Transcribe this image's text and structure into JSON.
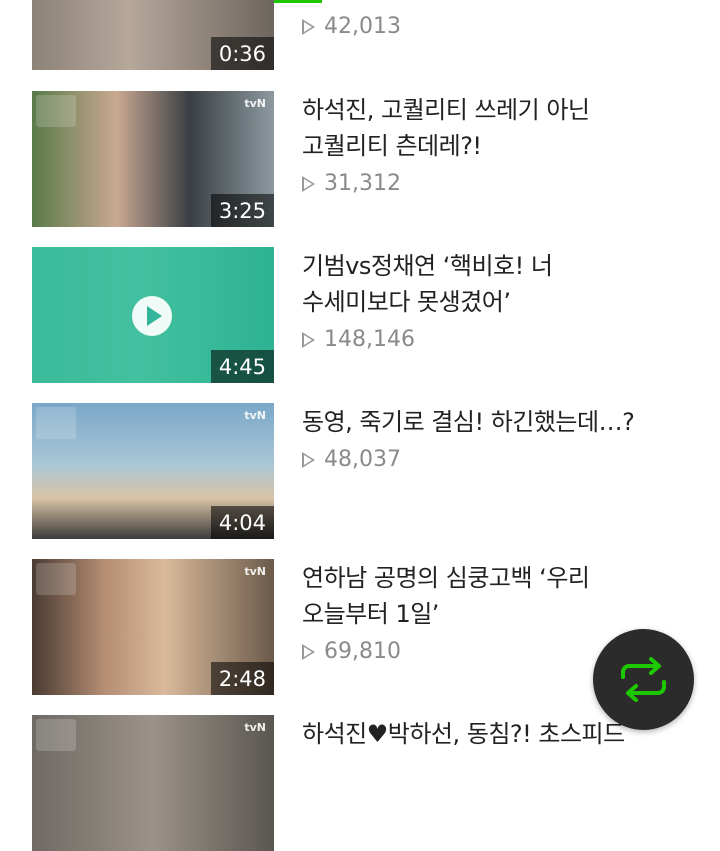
{
  "videos": [
    {
      "title_line1": "",
      "title_line2": "",
      "views": "42,013",
      "duration": "0:36"
    },
    {
      "title_line1": "하석진, 고퀄리티 쓰레기 아닌",
      "title_line2": "고퀄리티 츤데레?!",
      "views": "31,312",
      "duration": "3:25",
      "channel_logo": "tvN"
    },
    {
      "title_line1": "기범vs정채연 ‘핵비호! 너",
      "title_line2": "수세미보다 못생겼어’",
      "views": "148,146",
      "duration": "4:45"
    },
    {
      "title_line1": "동영, 죽기로 결심! 하긴했는데…?",
      "title_line2": "",
      "views": "48,037",
      "duration": "4:04",
      "channel_logo": "tvN"
    },
    {
      "title_line1": "연하남 공명의 심쿵고백 ‘우리",
      "title_line2": "오늘부터 1일’",
      "views": "69,810",
      "duration": "2:48",
      "channel_logo": "tvN"
    },
    {
      "title_line1": "하석진♥박하선, 동침?! 초스피드",
      "title_line2": "",
      "views": "",
      "duration": "",
      "channel_logo": "tvN"
    }
  ],
  "accent_color": "#1ec800",
  "fab": {
    "icon": "repeat-icon",
    "color": "#1ec800"
  }
}
